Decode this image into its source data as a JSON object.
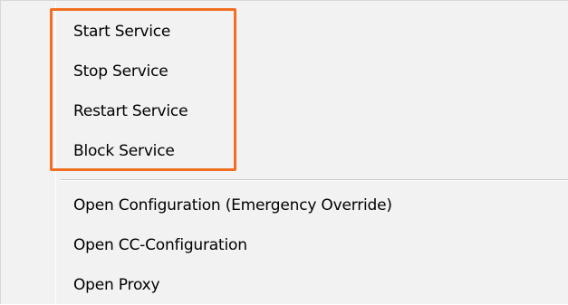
{
  "context_menu": {
    "service_group": [
      {
        "label": "Start Service"
      },
      {
        "label": "Stop Service"
      },
      {
        "label": "Restart Service"
      },
      {
        "label": "Block Service"
      }
    ],
    "config_group": [
      {
        "label": "Open Configuration (Emergency Override)"
      },
      {
        "label": "Open CC-Configuration"
      },
      {
        "label": "Open Proxy"
      }
    ]
  },
  "colors": {
    "menu_background": "#f2f2f2",
    "highlight_border": "#f26f21",
    "separator": "#c8c8c8"
  }
}
